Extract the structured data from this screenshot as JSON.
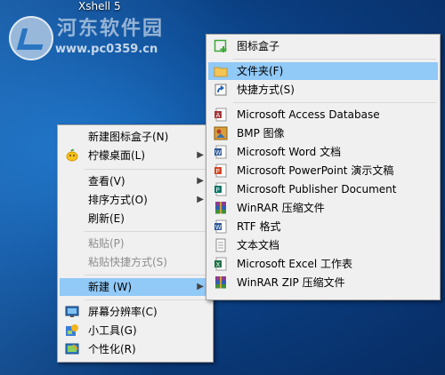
{
  "desktop": {
    "icon_label": "Xshell 5",
    "watermark": {
      "title": "河东软件园",
      "url": "www.pc0359.cn"
    }
  },
  "main_menu": {
    "items": [
      {
        "label": "新建图标盒子(N)",
        "icon": "fences-icon"
      },
      {
        "label": "柠檬桌面(L)",
        "icon": "lemon-icon",
        "submenu": true
      },
      {
        "label": "查看(V)",
        "submenu": true
      },
      {
        "label": "排序方式(O)",
        "submenu": true
      },
      {
        "label": "刷新(E)"
      },
      {
        "label": "粘贴(P)",
        "disabled": true
      },
      {
        "label": "粘贴快捷方式(S)",
        "disabled": true
      },
      {
        "label": "新建 (W)",
        "submenu": true,
        "highlighted": true
      },
      {
        "label": "屏幕分辨率(C)",
        "icon": "display-icon"
      },
      {
        "label": "小工具(G)",
        "icon": "gadgets-icon"
      },
      {
        "label": "个性化(R)",
        "icon": "personalize-icon"
      }
    ]
  },
  "new_submenu": {
    "items": [
      {
        "label": "图标盒子",
        "icon": "new-fence-icon"
      },
      {
        "label": "文件夹(F)",
        "icon": "folder-icon",
        "highlighted": true
      },
      {
        "label": "快捷方式(S)",
        "icon": "shortcut-icon"
      },
      {
        "label": "Microsoft Access Database",
        "icon": "access-icon"
      },
      {
        "label": "BMP 图像",
        "icon": "bmp-icon"
      },
      {
        "label": "Microsoft Word 文档",
        "icon": "word-icon"
      },
      {
        "label": "Microsoft PowerPoint 演示文稿",
        "icon": "powerpoint-icon"
      },
      {
        "label": "Microsoft Publisher Document",
        "icon": "publisher-icon"
      },
      {
        "label": "WinRAR 压缩文件",
        "icon": "winrar-icon"
      },
      {
        "label": "RTF 格式",
        "icon": "rtf-icon"
      },
      {
        "label": "文本文档",
        "icon": "text-document-icon"
      },
      {
        "label": "Microsoft Excel 工作表",
        "icon": "excel-icon"
      },
      {
        "label": "WinRAR ZIP 压缩文件",
        "icon": "winrar-zip-icon"
      }
    ]
  },
  "colors": {
    "highlight": "#91c9f7",
    "menu_bg": "#f0f0f0",
    "disabled_text": "#8d8d8d"
  }
}
